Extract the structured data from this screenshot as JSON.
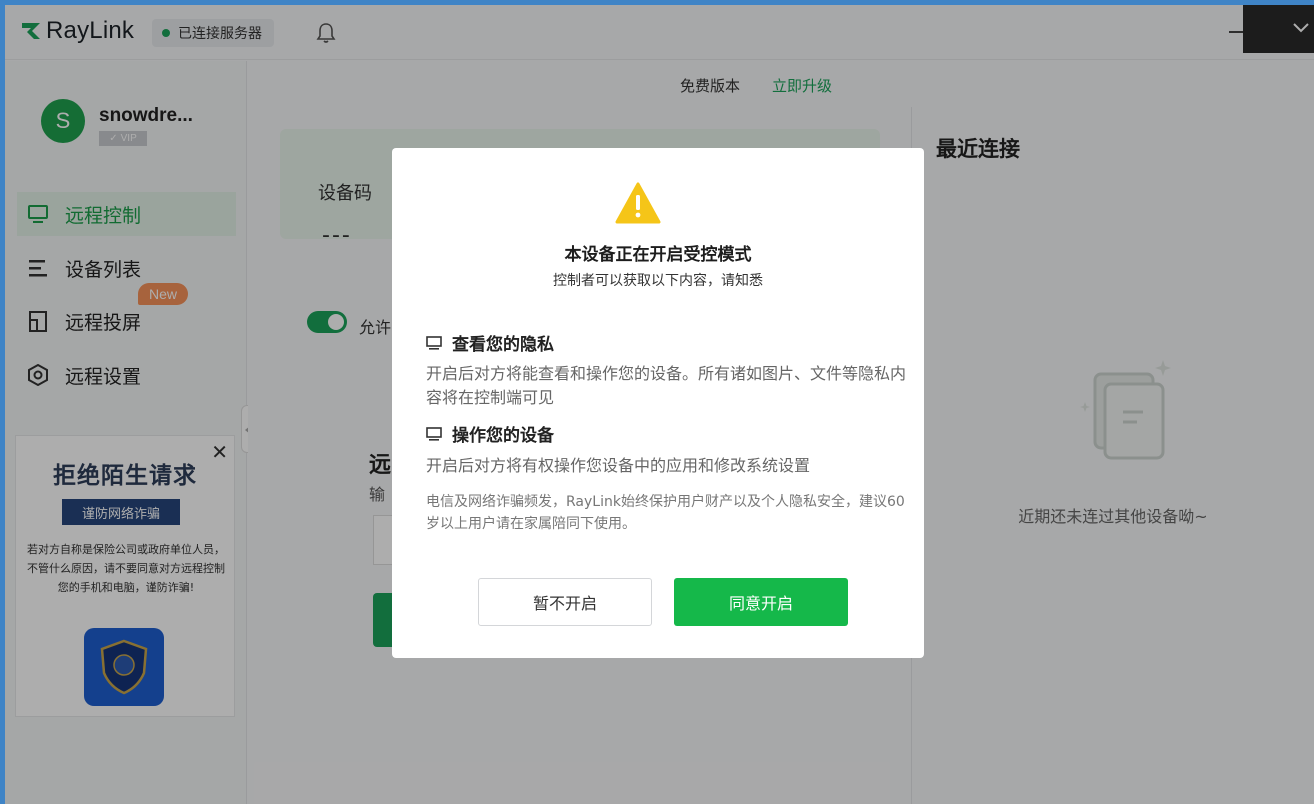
{
  "app": {
    "name": "RayLink",
    "connection_status": "已连接服务器"
  },
  "account": {
    "avatar_letter": "S",
    "username": "snowdre...",
    "tier": "VIP"
  },
  "header": {
    "plan": "免费版本",
    "upgrade": "立即升级"
  },
  "sidebar": {
    "items": [
      {
        "label": "远程控制",
        "active": true
      },
      {
        "label": "设备列表"
      },
      {
        "label": "远程投屏"
      },
      {
        "label": "远程设置"
      }
    ],
    "new_badge": "New"
  },
  "banner": {
    "title": "拒绝陌生请求",
    "tag": "谨防网络诈骗",
    "text": "若对方自称是保险公司或政府单位人员，不管什么原因，请不要同意对方远程控制您的手机和电脑，谨防诈骗!"
  },
  "main": {
    "device_code_label": "设备码",
    "device_code": "---",
    "allow_label": "允许",
    "remote_heading": "远",
    "remote_sub": "输"
  },
  "recent": {
    "title": "最近连接",
    "empty": "近期还未连过其他设备呦~"
  },
  "modal": {
    "title": "本设备正在开启受控模式",
    "subtitle": "控制者可以获取以下内容，请知悉",
    "sections": [
      {
        "title": "查看您的隐私",
        "desc": "开启后对方将能查看和操作您的设备。所有诸如图片、文件等隐私内容将在控制端可见"
      },
      {
        "title": "操作您的设备",
        "desc": "开启后对方将有权操作您设备中的应用和修改系统设置"
      }
    ],
    "note": "电信及网络诈骗频发，RayLink始终保护用户财产以及个人隐私安全，建议60岁以上用户请在家属陪同下使用。",
    "cancel": "暂不开启",
    "confirm": "同意开启"
  },
  "colors": {
    "brand_green": "#1ba35a",
    "confirm_green": "#15b84a",
    "warning_yellow": "#f5c518"
  }
}
